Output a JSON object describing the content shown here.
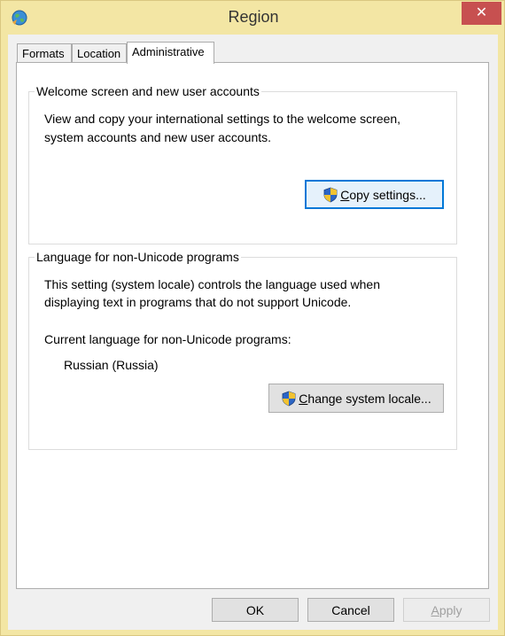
{
  "window": {
    "title": "Region",
    "close_glyph": "✕",
    "icon": "globe-icon"
  },
  "tabs": [
    {
      "label": "Formats",
      "active": false
    },
    {
      "label": "Location",
      "active": false
    },
    {
      "label": "Administrative",
      "active": true
    }
  ],
  "welcome_group": {
    "title": "Welcome screen and new user accounts",
    "description_line1": "View and copy your international settings to the welcome screen,",
    "description_line2": "system accounts and new user accounts.",
    "button": {
      "mnemonic": "C",
      "rest": "opy settings...",
      "icon": "uac-shield-icon"
    }
  },
  "locale_group": {
    "title": "Language for non-Unicode programs",
    "description_line1": "This setting (system locale) controls the language used when",
    "description_line2": "displaying text in programs that do not support Unicode.",
    "current_label": "Current language for non-Unicode programs:",
    "current_value": "Russian (Russia)",
    "button": {
      "mnemonic": "C",
      "rest": "hange system locale...",
      "icon": "uac-shield-icon"
    }
  },
  "dialog_buttons": {
    "ok": "OK",
    "cancel": "Cancel",
    "apply_mnemonic": "A",
    "apply_rest": "pply",
    "apply_enabled": false
  },
  "colors": {
    "frame": "#f3e6a4",
    "close_button": "#c75050",
    "focus": "#0078d7"
  }
}
